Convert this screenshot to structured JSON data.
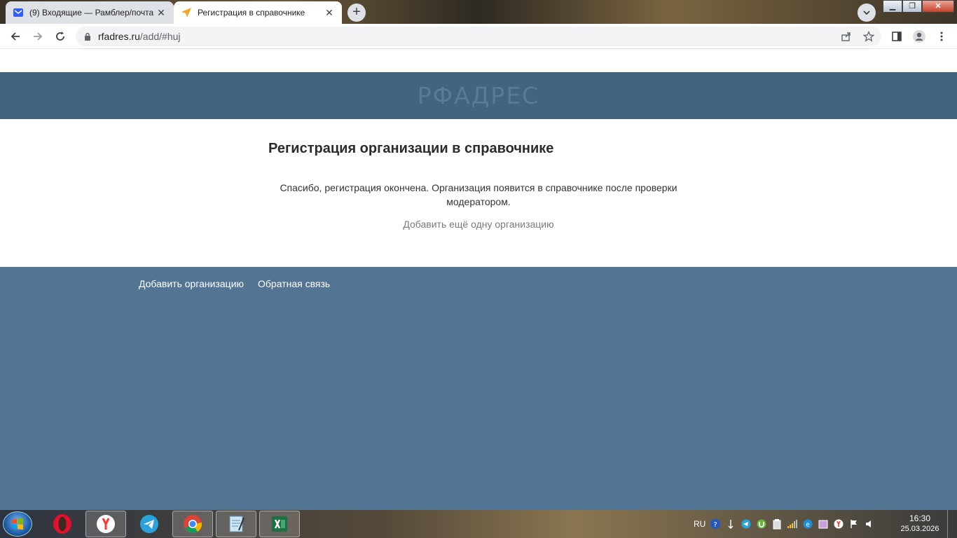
{
  "browser": {
    "tabs": [
      {
        "title": "(9) Входящие — Рамблер/почта",
        "icon": "mail-icon"
      },
      {
        "title": "Регистрация в справочнике",
        "icon": "navigation-arrow-icon"
      }
    ],
    "new_tab_label": "+",
    "close_glyph": "✕",
    "url_host": "rfadres.ru",
    "url_path": "/add/#huj"
  },
  "page": {
    "logo": "РФАДРЕС",
    "title": "Регистрация организации в справочнике",
    "message": "Спасибо, регистрация окончена. Организация появится в справочнике после проверки модератором.",
    "add_more_link": "Добавить ещё одну организацию",
    "footer_links": [
      "Добавить организацию",
      "Обратная связь"
    ],
    "colors": {
      "header": "#44637d",
      "footer": "#537593"
    }
  },
  "taskbar": {
    "apps": [
      "opera-icon",
      "yandex-browser-icon",
      "telegram-icon",
      "chrome-icon",
      "notepad-icon",
      "excel-icon"
    ],
    "tray_lang": "RU",
    "time": "16:30",
    "date": "25.03.2026"
  }
}
